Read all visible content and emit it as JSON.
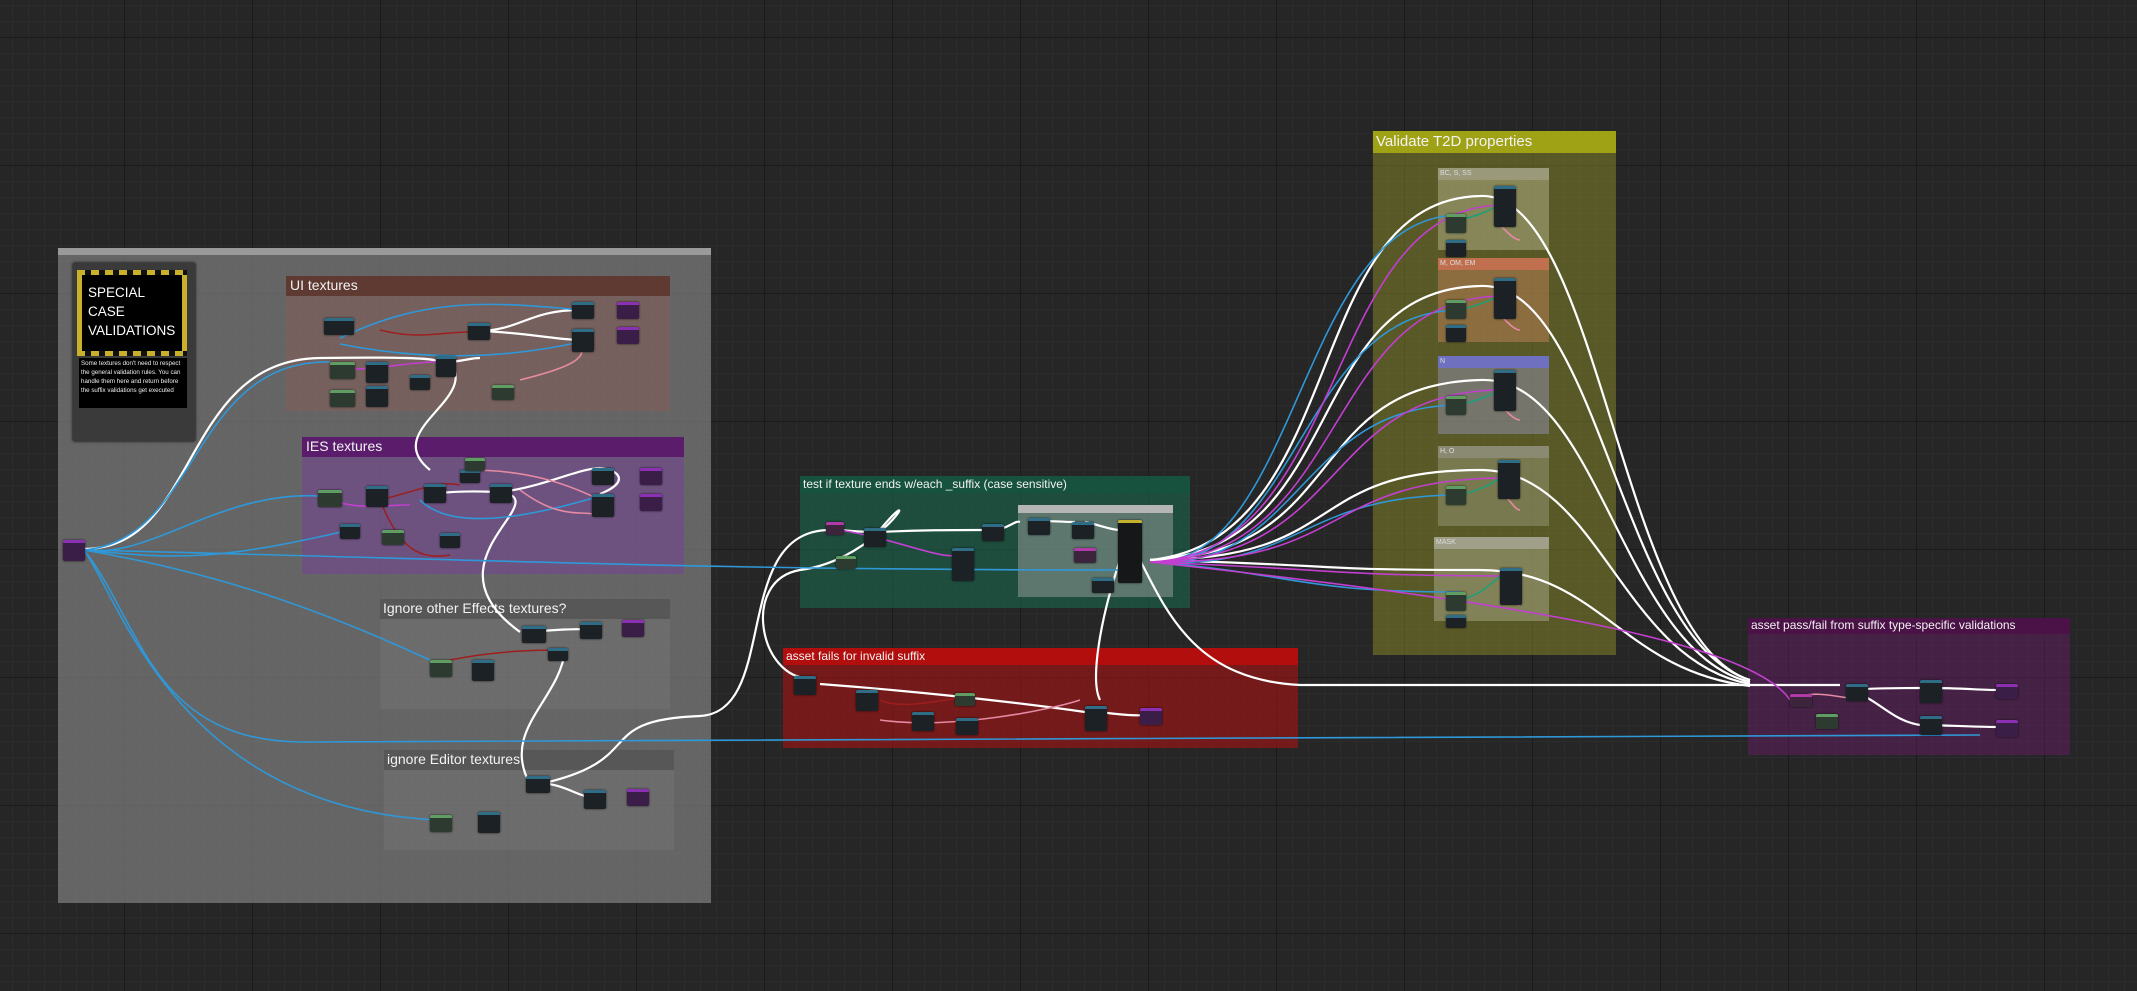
{
  "graph": {
    "grid_color": "#262626",
    "comments": {
      "special_region": {
        "title": "",
        "color": "#7a7a7a"
      },
      "ui_textures": {
        "title": "UI textures",
        "color": "#6b3a2e"
      },
      "ies_textures": {
        "title": "IES textures",
        "color": "#5a1c6a"
      },
      "ignore_effects": {
        "title": "Ignore other Effects textures?",
        "color": "#555555"
      },
      "ignore_editor": {
        "title": "ignore Editor textures",
        "color": "#555555"
      },
      "test_suffix": {
        "title": "test if texture ends w/each _suffix (case sensitive)",
        "color": "#16553f"
      },
      "asset_fails": {
        "title": "asset fails for invalid suffix",
        "color": "#b31111"
      },
      "validate_t2d": {
        "title": "Validate T2D properties",
        "color": "#a2a416"
      },
      "pass_fail": {
        "title": "asset pass/fail from suffix type-specific validations",
        "color": "#4a1448"
      }
    },
    "special_card": {
      "heading": "SPECIAL\nCASE\nVALIDATIONS",
      "description": "Some textures don't need to respect the general validation rules. You can handle them here and return before the suffix validations get executed"
    },
    "validate_subgroups": [
      {
        "title": "BC, S, SS",
        "color": "#8a8a6a"
      },
      {
        "title": "M, OM, EM",
        "color": "#b86a4a"
      },
      {
        "title": "N",
        "color": "#6a6ab8"
      },
      {
        "title": "H, O",
        "color": "#7a7a6a"
      },
      {
        "title": "MASK",
        "color": "#8a8a7a"
      }
    ]
  }
}
